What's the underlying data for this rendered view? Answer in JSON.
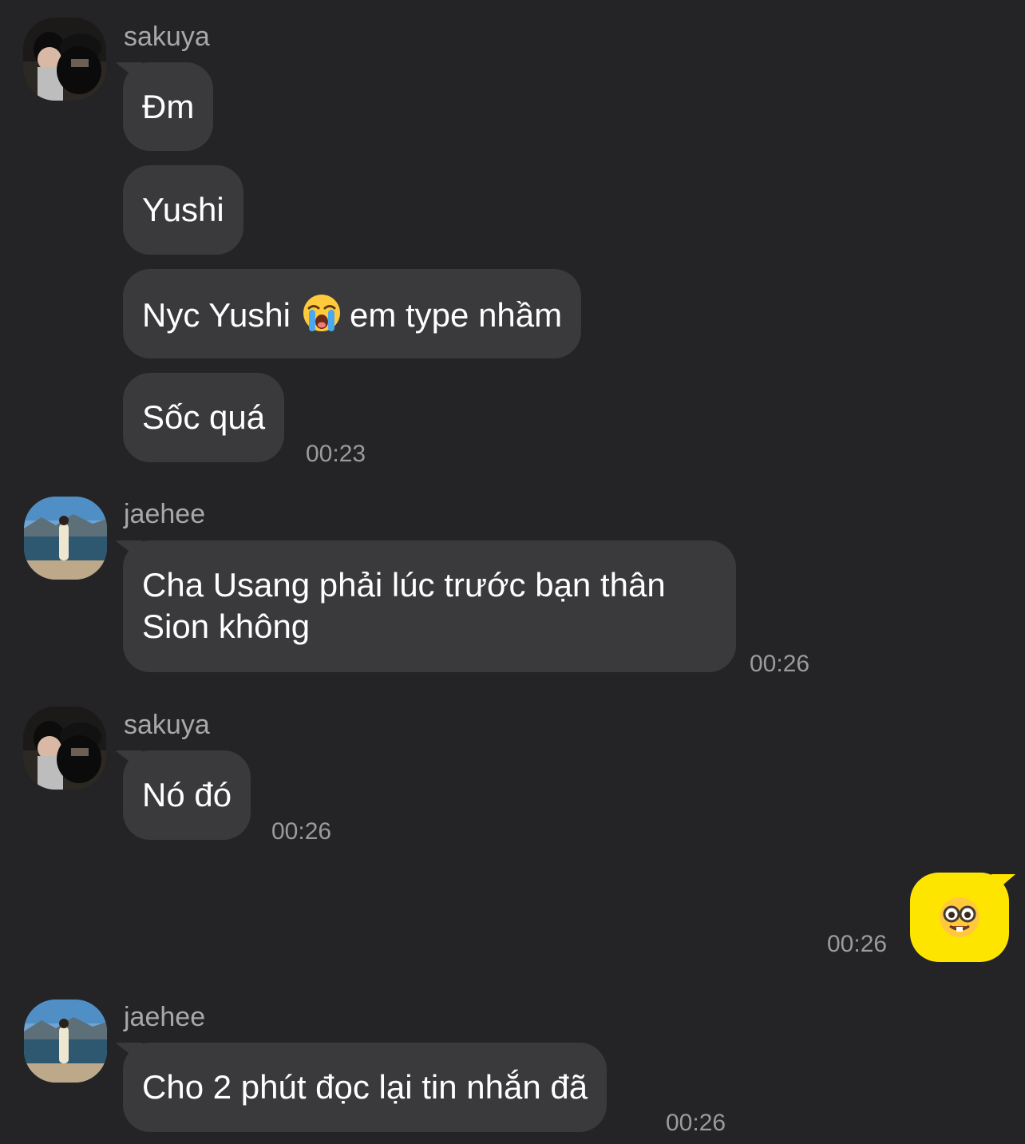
{
  "messages": [
    {
      "sender": "sakuya",
      "avatar_icon": "avatar-photo-sakuya",
      "bubbles": [
        "Đm",
        "Yushi"
      ],
      "bubble3": {
        "before": "Nyc Yushi",
        "emoji": "loudly-crying-face",
        "after": "em type nhầm"
      },
      "bubble4": "Sốc quá",
      "time": "00:23"
    },
    {
      "sender": "jaehee",
      "avatar_icon": "avatar-photo-jaehee",
      "text": "Cha Usang phải lúc trước bạn thân Sion không",
      "time": "00:26"
    },
    {
      "sender": "sakuya",
      "avatar_icon": "avatar-photo-sakuya",
      "text": "Nó đó",
      "time": "00:26"
    },
    {
      "sender": "me",
      "emoji": "nerd-face",
      "time": "00:26"
    },
    {
      "sender": "jaehee",
      "avatar_icon": "avatar-photo-jaehee",
      "text": "Cho 2 phút đọc lại tin nhắn đã",
      "time": "00:26"
    }
  ],
  "colors": {
    "background": "#242426",
    "incoming_bubble": "#3a3a3c",
    "outgoing_bubble": "#fee500",
    "sender_text": "#a8a8ab",
    "time_text": "#9b9b9e"
  }
}
